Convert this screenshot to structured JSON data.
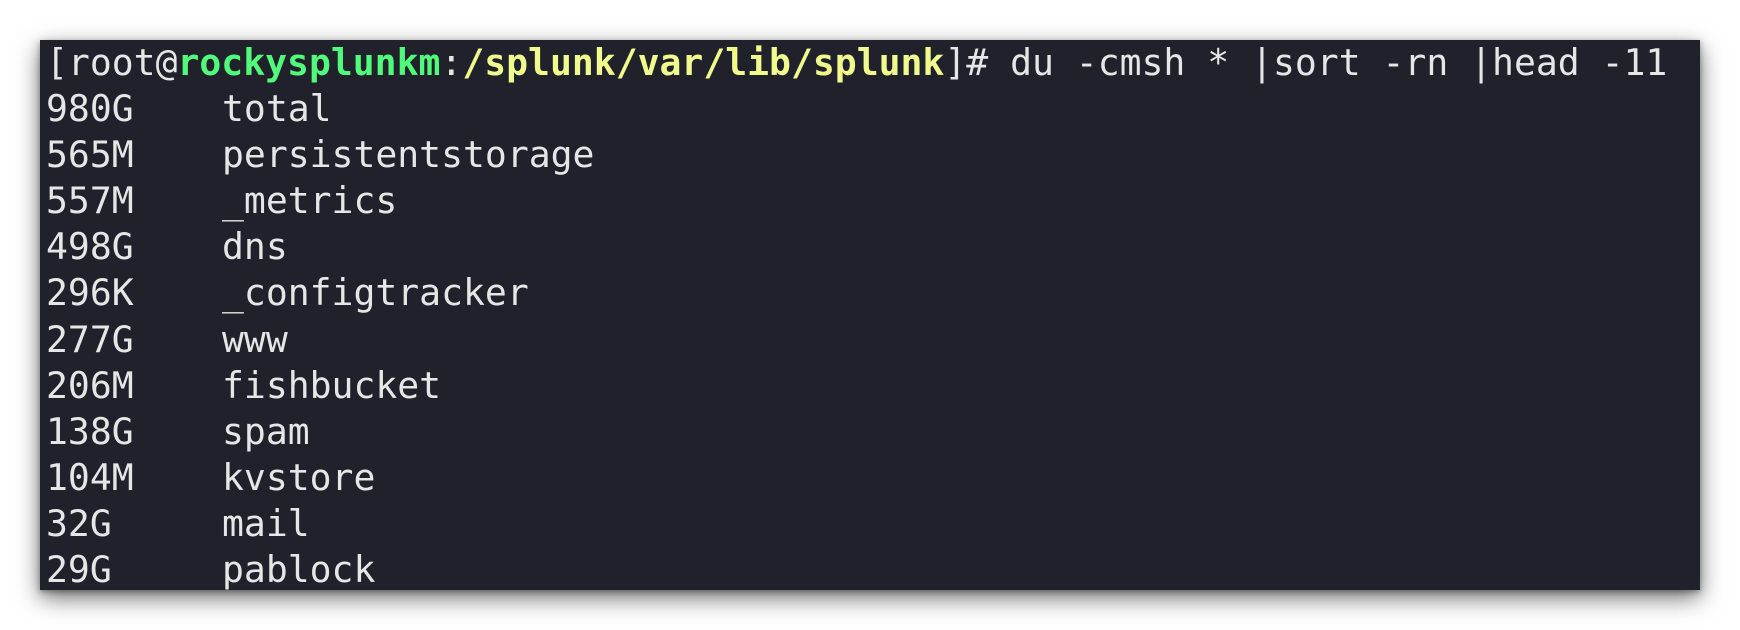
{
  "colors": {
    "terminal_bg": "#20212b",
    "text": "#e6e6e6",
    "hostname": "#50fa7b",
    "path": "#f1fa8c"
  },
  "prompt": {
    "open_bracket": "[",
    "user": "root",
    "at": "@",
    "host": "rockysplunkm",
    "colon": ":",
    "path": "/splunk/var/lib/splunk",
    "close": "]# ",
    "command": "du -cmsh * |sort -rn |head -11"
  },
  "output": [
    {
      "size": "980G",
      "name": "total"
    },
    {
      "size": "565M",
      "name": "persistentstorage"
    },
    {
      "size": "557M",
      "name": "_metrics"
    },
    {
      "size": "498G",
      "name": "dns"
    },
    {
      "size": "296K",
      "name": "_configtracker"
    },
    {
      "size": "277G",
      "name": "www"
    },
    {
      "size": "206M",
      "name": "fishbucket"
    },
    {
      "size": "138G",
      "name": "spam"
    },
    {
      "size": "104M",
      "name": "kvstore"
    },
    {
      "size": "32G",
      "name": "mail"
    },
    {
      "size": "29G",
      "name": "pablock"
    }
  ]
}
